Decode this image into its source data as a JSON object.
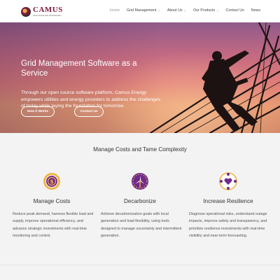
{
  "brand": {
    "name": "CAMUS",
    "tagline": "Grid Control and Orchestration"
  },
  "nav": {
    "items": [
      {
        "label": "Home",
        "active": true,
        "dropdown": false
      },
      {
        "label": "Grid Management",
        "active": false,
        "dropdown": true
      },
      {
        "label": "About Us",
        "active": false,
        "dropdown": true
      },
      {
        "label": "Our Products",
        "active": false,
        "dropdown": true
      },
      {
        "label": "Contact Us",
        "active": false,
        "dropdown": false
      },
      {
        "label": "News",
        "active": false,
        "dropdown": false
      }
    ]
  },
  "hero": {
    "title": "Grid Management Software as a Service",
    "body": "Through our open source software platform, Camus Energy empowers utilities and energy providers to address the challenges of today while laying the foundation for tomorrow.",
    "buttons": {
      "how": "How It Works",
      "contact": "Contact Us"
    }
  },
  "section": {
    "title": "Manage Costs and Tame Complexity",
    "features": [
      {
        "title": "Manage Costs",
        "icon": "dollar-coin-icon",
        "text": "Reduce peak demand, harness flexible load and supply, improve operational efficiency, and advance strategic investments with real-time monitoring and control."
      },
      {
        "title": "Decarbonize",
        "icon": "wind-turbine-icon",
        "text": "Achieve decarbonization goals with local generation and load flexibility, using tools designed to manage uncertainty and intermittent generation."
      },
      {
        "title": "Increase Resilience",
        "icon": "network-heart-icon",
        "text": "Diagnose operational risks, understand outage impacts, improve safety and transparency, and prioritize resilience investments with real-time visibility and near-term forecasting."
      }
    ]
  },
  "colors": {
    "brand": "#7a1a35",
    "accent": "#e8a84a",
    "icon_ring": "#f0b445",
    "icon_fill": "#6f2a8a"
  }
}
